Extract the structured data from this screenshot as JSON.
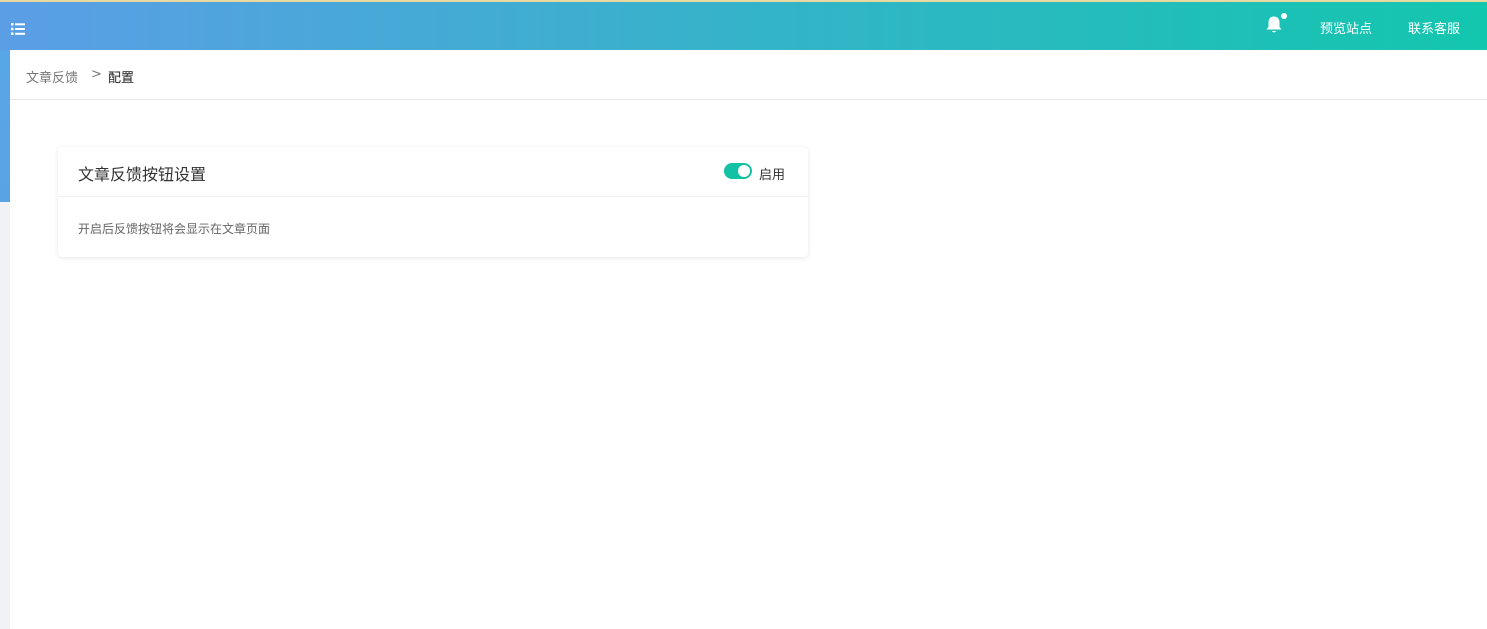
{
  "header": {
    "notification_icon": "bell-icon",
    "preview_site_label": "预览站点",
    "contact_support_label": "联系客服",
    "gradient_start": "#5b9ee6",
    "gradient_end": "#13c6ae"
  },
  "breadcrumb": {
    "items": [
      "文章反馈",
      "配置"
    ],
    "separator": ">"
  },
  "card": {
    "title": "文章反馈按钮设置",
    "toggle": {
      "enabled": true,
      "label": "启用",
      "color": "#13c2a4"
    },
    "description": "开启后反馈按钮将会显示在文章页面"
  }
}
